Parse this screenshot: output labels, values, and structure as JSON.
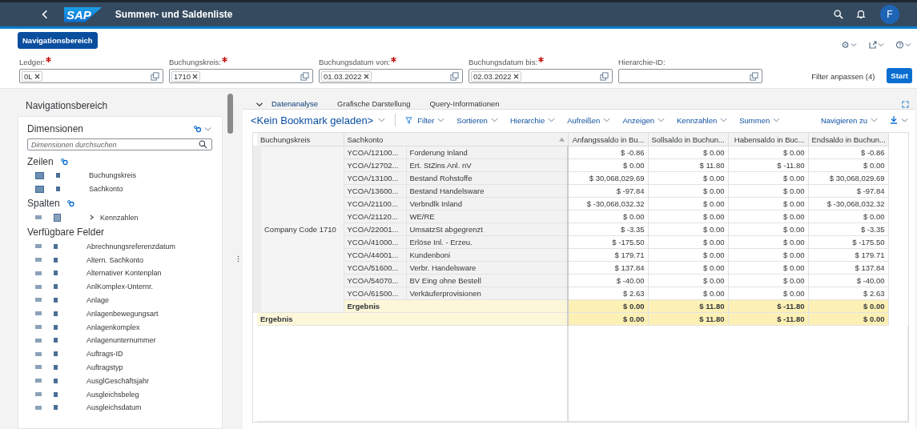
{
  "shell": {
    "logo": "SAP",
    "title": "Summen- und Saldenliste",
    "avatar": "F"
  },
  "nav_button": "Navigationsbereich",
  "filters": [
    {
      "label": "Ledger:",
      "required": true,
      "tokens": [
        "0L"
      ]
    },
    {
      "label": "Buchungskreis:",
      "required": true,
      "tokens": [
        "1710"
      ]
    },
    {
      "label": "Buchungsdatum von:",
      "required": true,
      "tokens": [
        "01.03.2022"
      ]
    },
    {
      "label": "Buchungsdatum bis:",
      "required": true,
      "tokens": [
        "02.03.2022"
      ]
    },
    {
      "label": "Hierarchie-ID:",
      "required": false
    }
  ],
  "filter_link": "Filter anpassen (4)",
  "start_button": "Start",
  "navigation": {
    "title": "Navigationsbereich",
    "dimensions_title": "Dimensionen",
    "search": {
      "placeholder": "Dimensionen durchsuchen"
    },
    "sections": [
      {
        "title": "Zeilen",
        "kind": "rows",
        "items": [
          {
            "label": "Buchungskreis"
          },
          {
            "label": "Sachkonto"
          }
        ]
      },
      {
        "title": "Spalten",
        "kind": "columns",
        "items": [
          {
            "label": "Kennzahlen",
            "expanded": false
          }
        ]
      },
      {
        "title": "Verfügbare Felder",
        "kind": "free",
        "items": [
          {
            "label": "Abrechnungsreferenzdatum"
          },
          {
            "label": "Altern. Sachkonto"
          },
          {
            "label": "Alternativer Kontenplan"
          },
          {
            "label": "AnlKomplex-Unternr."
          },
          {
            "label": "Anlage"
          },
          {
            "label": "Anlagenbewegungsart"
          },
          {
            "label": "Anlagenkomplex"
          },
          {
            "label": "Anlagenunternummer"
          },
          {
            "label": "Auftrags-ID"
          },
          {
            "label": "Auftragstyp"
          },
          {
            "label": "AusglGeschäftsjahr"
          },
          {
            "label": "Ausgleichsbeleg"
          },
          {
            "label": "Ausgleichsdatum"
          }
        ]
      }
    ]
  },
  "tabs": [
    {
      "label": "Datenanalyse",
      "selected": true
    },
    {
      "label": "Grafische Darstellung",
      "selected": false
    },
    {
      "label": "Query-Informationen",
      "selected": false
    }
  ],
  "toolbar": {
    "bookmark": "<Kein Bookmark geladen>",
    "menus": [
      "Filter",
      "Sortieren",
      "Hierarchie",
      "Aufreißen",
      "Anzeigen",
      "Kennzahlen",
      "Summen"
    ],
    "navigate": "Navigieren zu"
  },
  "table": {
    "columns": [
      "Buchungskreis",
      "Sachkonto",
      "Anfangssaldo in Bu...",
      "Sollsaldo in Buchun...",
      "Habensaldo in Buc...",
      "Endsaldo in Buchun..."
    ],
    "group": "Company Code 1710",
    "rows": [
      {
        "code": "YCOA/12100...",
        "name": "Forderung Inland",
        "values": [
          "$ -0.86",
          "$ 0.00",
          "$ 0.00",
          "$ -0.86"
        ]
      },
      {
        "code": "YCOA/12702...",
        "name": "Ert. StZins Anl. nV",
        "values": [
          "$ 0.00",
          "$ 11.80",
          "$ -11.80",
          "$ 0.00"
        ]
      },
      {
        "code": "YCOA/13100...",
        "name": "Bestand Rohstoffe",
        "values": [
          "$ 30,068,029.69",
          "$ 0.00",
          "$ 0.00",
          "$ 30,068,029.69"
        ]
      },
      {
        "code": "YCOA/13600...",
        "name": "Bestand Handelsware",
        "values": [
          "$ -97.84",
          "$ 0.00",
          "$ 0.00",
          "$ -97.84"
        ]
      },
      {
        "code": "YCOA/21100...",
        "name": "Verbndlk Inland",
        "values": [
          "$ -30,068,032.32",
          "$ 0.00",
          "$ 0.00",
          "$ -30,068,032.32"
        ]
      },
      {
        "code": "YCOA/21120...",
        "name": "WE/RE",
        "values": [
          "$ 0.00",
          "$ 0.00",
          "$ 0.00",
          "$ 0.00"
        ]
      },
      {
        "code": "YCOA/22001...",
        "name": "UmsatzSt abgegrenzt",
        "values": [
          "$ -3.35",
          "$ 0.00",
          "$ 0.00",
          "$ -3.35"
        ]
      },
      {
        "code": "YCOA/41000...",
        "name": "Erlöse Inl. - Erzeu.",
        "values": [
          "$ -175.50",
          "$ 0.00",
          "$ 0.00",
          "$ -175.50"
        ]
      },
      {
        "code": "YCOA/44001...",
        "name": "Kundenboni",
        "values": [
          "$ 179.71",
          "$ 0.00",
          "$ 0.00",
          "$ 179.71"
        ]
      },
      {
        "code": "YCOA/51600...",
        "name": "Verbr. Handelsware",
        "values": [
          "$ 137.84",
          "$ 0.00",
          "$ 0.00",
          "$ 137.84"
        ]
      },
      {
        "code": "YCOA/54070...",
        "name": "BV Eing ohne Bestell",
        "values": [
          "$ -40.00",
          "$ 0.00",
          "$ 0.00",
          "$ -40.00"
        ]
      },
      {
        "code": "YCOA/61500...",
        "name": "Verkäuferprovisionen",
        "values": [
          "$ 2.63",
          "$ 0.00",
          "$ 0.00",
          "$ 2.63"
        ]
      }
    ],
    "subtotal": {
      "label": "Ergebnis",
      "values": [
        "$ 0.00",
        "$ 11.80",
        "$ -11.80",
        "$ 0.00"
      ]
    },
    "total": {
      "label": "Ergebnis",
      "values": [
        "$ 0.00",
        "$ 11.80",
        "$ -11.80",
        "$ 0.00"
      ]
    }
  }
}
